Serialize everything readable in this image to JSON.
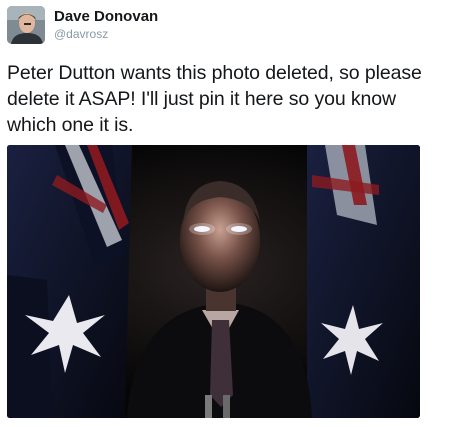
{
  "tweet": {
    "author": {
      "display_name": "Dave Donovan",
      "handle": "@davrosz",
      "avatar_icon": "user-avatar-photo"
    },
    "text_lines": [
      "Peter Dutton wants this photo deleted, so please",
      "delete it ASAP! I'll just pin it here so you know",
      "which one it is."
    ],
    "media": {
      "type": "photo",
      "subject": "man-in-suit-in-front-of-flags"
    }
  },
  "colors": {
    "name_text": "#14171a",
    "handle_text": "#8899a6",
    "body_text": "#14171a",
    "photo_background": "#050505",
    "flag_blue": "#0d1530",
    "flag_red": "#8c1a1f"
  }
}
